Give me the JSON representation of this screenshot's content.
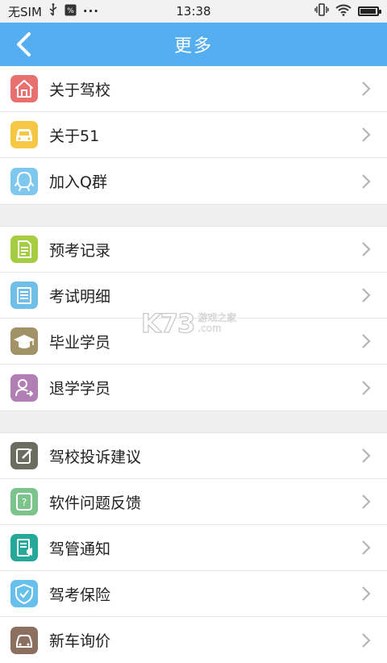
{
  "status_bar": {
    "carrier": "无SIM",
    "dots": "···",
    "time": "13:38"
  },
  "header": {
    "title": "更多"
  },
  "groups": [
    [
      {
        "label": "关于驾校",
        "icon": "house-icon",
        "color": "#e8706e"
      },
      {
        "label": "关于51",
        "icon": "car-icon",
        "color": "#f6c744"
      },
      {
        "label": "加入Q群",
        "icon": "qq-icon",
        "color": "#7ec8ef"
      }
    ],
    [
      {
        "label": "预考记录",
        "icon": "document-icon",
        "color": "#a6cc42"
      },
      {
        "label": "考试明细",
        "icon": "list-icon",
        "color": "#6fbfe8"
      },
      {
        "label": "毕业学员",
        "icon": "graduation-cap-icon",
        "color": "#a39168"
      },
      {
        "label": "退学学员",
        "icon": "user-exit-icon",
        "color": "#b17fb3"
      }
    ],
    [
      {
        "label": "驾校投诉建议",
        "icon": "edit-icon",
        "color": "#6a6d60"
      },
      {
        "label": "软件问题反馈",
        "icon": "feedback-icon",
        "color": "#7bc58d"
      },
      {
        "label": "驾管通知",
        "icon": "notice-icon",
        "color": "#25a89a"
      },
      {
        "label": "驾考保险",
        "icon": "shield-icon",
        "color": "#67c0ec"
      },
      {
        "label": "新车询价",
        "icon": "car-price-icon",
        "color": "#8b7060"
      }
    ]
  ],
  "watermark": {
    "logo": "K73",
    "line1": "游戏之家",
    "line2": ".com"
  },
  "colors": {
    "header": "#55aef0",
    "divider": "#efefef"
  }
}
